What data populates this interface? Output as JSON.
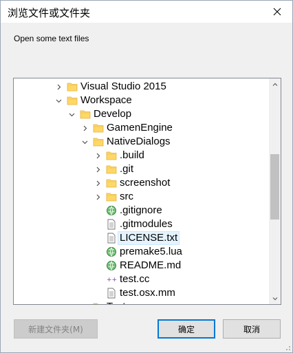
{
  "window": {
    "title": "浏览文件或文件夹"
  },
  "description": "Open some text files",
  "tree": {
    "rows": [
      {
        "label": "Visual Studio 2015",
        "type": "folder",
        "expander": "collapsed"
      },
      {
        "label": "Workspace",
        "type": "folder",
        "expander": "expanded"
      },
      {
        "label": "Develop",
        "type": "folder",
        "expander": "expanded"
      },
      {
        "label": "GamenEngine",
        "type": "folder",
        "expander": "collapsed"
      },
      {
        "label": "NativeDialogs",
        "type": "folder",
        "expander": "expanded"
      },
      {
        "label": ".build",
        "type": "folder",
        "expander": "collapsed"
      },
      {
        "label": ".git",
        "type": "folder",
        "expander": "collapsed"
      },
      {
        "label": "screenshot",
        "type": "folder",
        "expander": "collapsed"
      },
      {
        "label": "src",
        "type": "folder",
        "expander": "collapsed"
      },
      {
        "label": ".gitignore",
        "type": "file",
        "icon": "green-globe-icon"
      },
      {
        "label": ".gitmodules",
        "type": "file",
        "icon": "text-file-icon"
      },
      {
        "label": "LICENSE.txt",
        "type": "file",
        "icon": "text-file-icon",
        "selected": true
      },
      {
        "label": "premake5.lua",
        "type": "file",
        "icon": "green-globe-icon"
      },
      {
        "label": "README.md",
        "type": "file",
        "icon": "green-globe-icon"
      },
      {
        "label": "test.cc",
        "type": "file",
        "icon": "cpp-file-icon"
      },
      {
        "label": "test.osx.mm",
        "type": "file",
        "icon": "text-file-icon"
      },
      {
        "label": "Test",
        "type": "folder",
        "expander": "collapsed"
      }
    ]
  },
  "buttons": {
    "new_folder": "新建文件夹(M)",
    "ok": "确定",
    "cancel": "取消"
  },
  "colors": {
    "accent": "#0078d7",
    "folder": "#ffd766",
    "selection": "#e5f3ff"
  }
}
